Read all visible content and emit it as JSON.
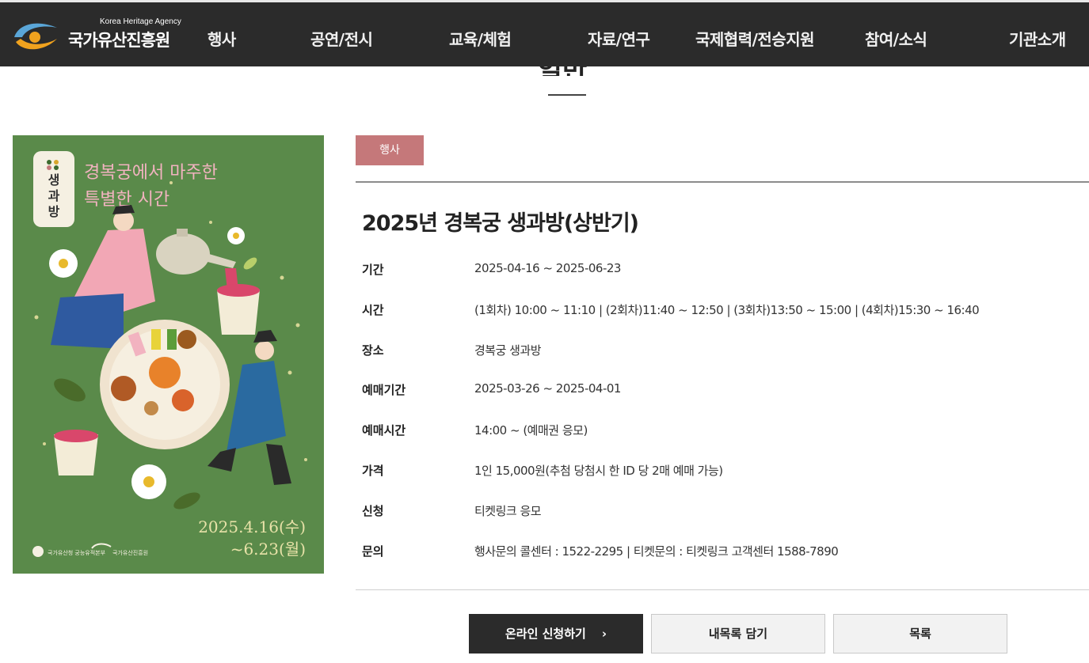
{
  "header": {
    "logo_en": "Korea Heritage Agency",
    "logo_ko": "국가유산진흥원",
    "nav": [
      {
        "label": "행사"
      },
      {
        "label": "공연/전시"
      },
      {
        "label": "교육/체험"
      },
      {
        "label": "자료/연구"
      },
      {
        "label": "국제협력/전승지원"
      },
      {
        "label": "참여/소식"
      },
      {
        "label": "기관소개"
      }
    ]
  },
  "page": {
    "section_title": "일반"
  },
  "poster": {
    "logo_text": [
      "생",
      "과",
      "방"
    ],
    "headline_1": "경복궁에서 마주한",
    "headline_2": "특별한 시간",
    "date_1": "2025.4.16(수)",
    "date_2": "~6.23(월)",
    "footer_1": "국가유산청 궁능유적본부",
    "footer_2": "국가유산진흥원"
  },
  "event": {
    "category": "행사",
    "title": "2025년 경복궁 생과방(상반기)",
    "details": [
      {
        "label": "기간",
        "value": "2025-04-16 ~ 2025-06-23"
      },
      {
        "label": "시간",
        "value": "(1회차) 10:00 ~ 11:10 | (2회차)11:40 ~ 12:50 | (3회차)13:50 ~ 15:00 | (4회차)15:30 ~ 16:40"
      },
      {
        "label": "장소",
        "value": "경복궁 생과방"
      },
      {
        "label": "예매기간",
        "value": "2025-03-26 ~ 2025-04-01"
      },
      {
        "label": "예매시간",
        "value": "14:00 ~ (예매권 응모)"
      },
      {
        "label": "가격",
        "value": "1인 15,000원(추첨 당첨시 한 ID 당 2매 예매 가능)"
      },
      {
        "label": "신청",
        "value": "티켓링크 응모"
      },
      {
        "label": "문의",
        "value": "행사문의 콜센터 : 1522-2295 | 티켓문의 : 티켓링크 고객센터 1588-7890"
      }
    ]
  },
  "actions": {
    "apply_label": "온라인 신청하기",
    "apply_arrow": "›",
    "save_label": "내목록 담기",
    "list_label": "목록"
  },
  "colors": {
    "header_bg": "#2b2b2b",
    "tag_bg": "#c5787a",
    "poster_bg": "#5a8a4a"
  }
}
